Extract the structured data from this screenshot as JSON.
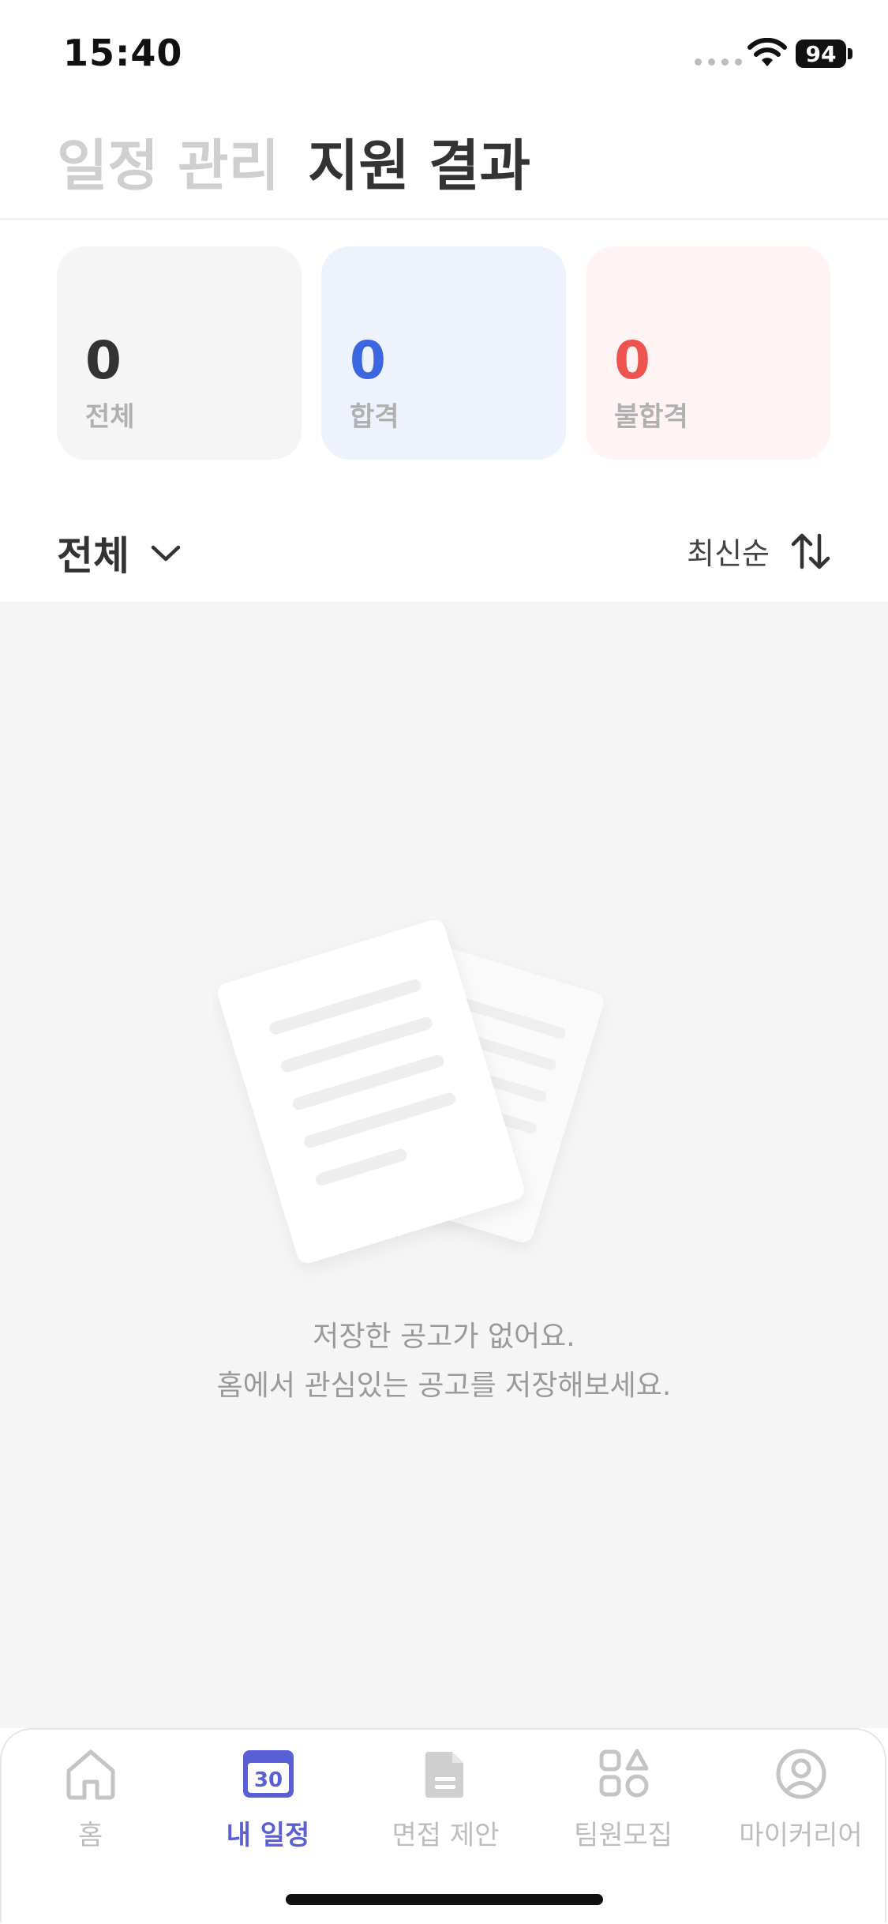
{
  "status_bar": {
    "time": "15:40",
    "battery": "94"
  },
  "header": {
    "tabs": [
      {
        "label": "일정 관리",
        "active": false
      },
      {
        "label": "지원 결과",
        "active": true
      }
    ]
  },
  "stats": {
    "total": {
      "value": "0",
      "label": "전체"
    },
    "pass": {
      "value": "0",
      "label": "합격"
    },
    "fail": {
      "value": "0",
      "label": "불합격"
    }
  },
  "filter": {
    "selected": "전체",
    "sort_label": "최신순"
  },
  "empty_state": {
    "line1": "저장한 공고가 없어요.",
    "line2": "홈에서 관심있는 공고를 저장해보세요."
  },
  "tabbar": {
    "items": [
      {
        "label": "홈",
        "icon": "home-icon",
        "active": false
      },
      {
        "label": "내 일정",
        "icon": "calendar-icon",
        "active": true,
        "badge": "30"
      },
      {
        "label": "면접 제안",
        "icon": "document-icon",
        "active": false
      },
      {
        "label": "팀원모집",
        "icon": "shapes-icon",
        "active": false
      },
      {
        "label": "마이커리어",
        "icon": "profile-icon",
        "active": false
      }
    ]
  },
  "colors": {
    "accent": "#5b5fd6",
    "pass": "#3a66e0",
    "fail": "#ef5350",
    "inactive": "#bdbdbd"
  }
}
